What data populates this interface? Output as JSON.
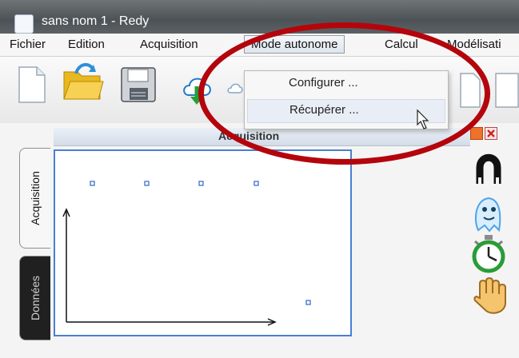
{
  "window": {
    "title": "sans nom 1 - Redy"
  },
  "menubar": {
    "items": [
      {
        "label": "Fichier"
      },
      {
        "label": "Edition"
      },
      {
        "label": "Acquisition"
      },
      {
        "label": "Mode autonome"
      },
      {
        "label": "Calcul"
      },
      {
        "label": "Modélisati"
      }
    ],
    "active": "Mode autonome"
  },
  "dropdown": {
    "items": [
      {
        "label": "Configurer ..."
      },
      {
        "label": "Récupérer ..."
      }
    ],
    "hovered": "Récupérer ..."
  },
  "toolbar": {
    "icons": [
      "new-document-icon",
      "open-folder-icon",
      "save-icon",
      "cloud-download-icon",
      "cloud-icon",
      "copy-document-icon",
      "document-icon"
    ]
  },
  "panel": {
    "title": "Acquisition"
  },
  "side_tabs": [
    {
      "label": "Acquisition",
      "selected": true
    },
    {
      "label": "Données",
      "selected": false
    }
  ],
  "tools": {
    "icons": [
      "magnet-icon",
      "ghost-icon",
      "stopwatch-icon",
      "hand-icon"
    ]
  },
  "colors": {
    "highlight_ring": "#b4050c",
    "plot_border": "#4a7fd1",
    "marker": "#2f66c4"
  }
}
